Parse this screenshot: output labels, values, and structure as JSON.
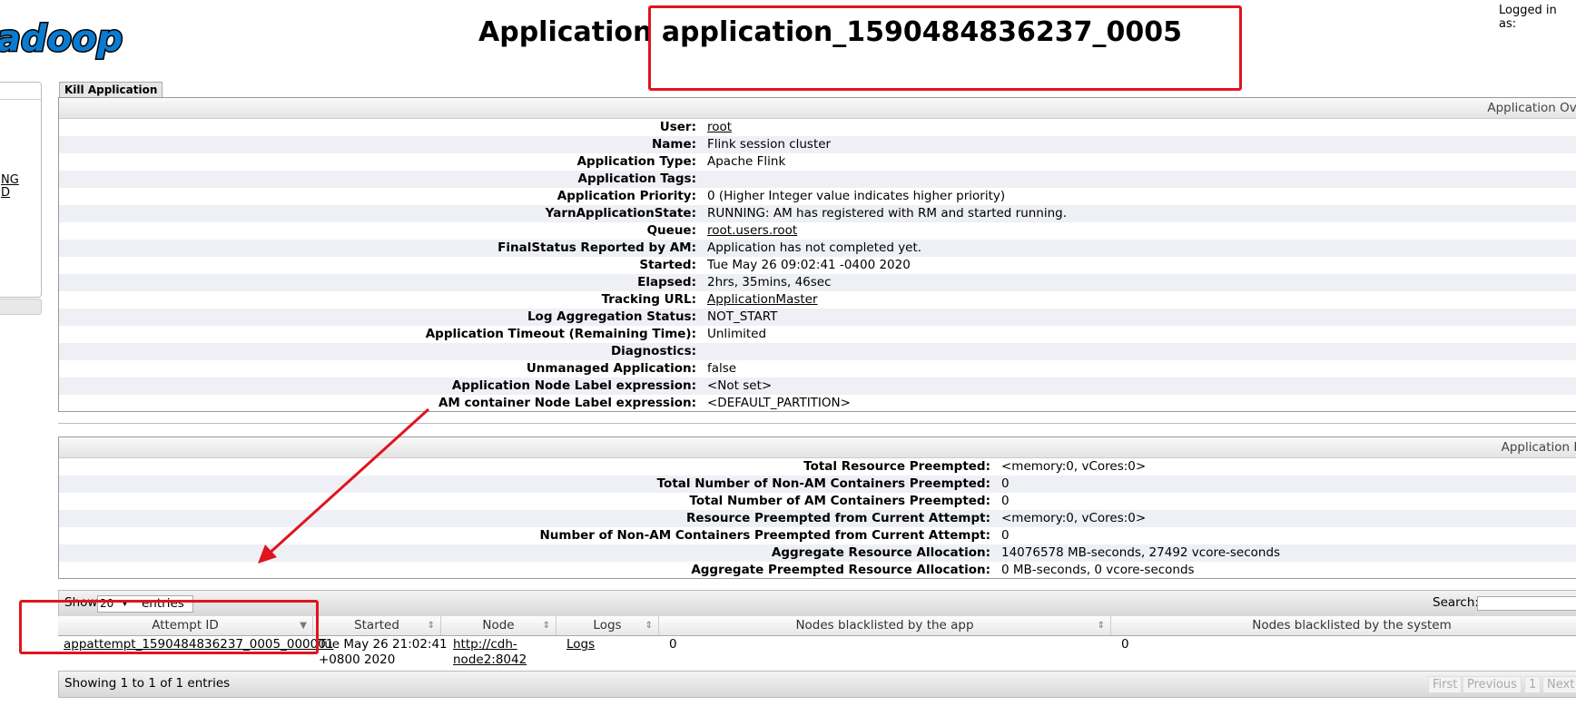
{
  "header": {
    "logo_text": "adoop",
    "title_prefix": "Application",
    "title_app_id": "application_1590484836237_0005",
    "logged_in": "Logged in as:"
  },
  "nav": {
    "links": [
      "NG",
      "D"
    ]
  },
  "kill_button": "Kill Application",
  "overview": {
    "header": "Application Ove",
    "rows": [
      {
        "key": "User:",
        "value": "root",
        "link": true
      },
      {
        "key": "Name:",
        "value": "Flink session cluster"
      },
      {
        "key": "Application Type:",
        "value": "Apache Flink"
      },
      {
        "key": "Application Tags:",
        "value": ""
      },
      {
        "key": "Application Priority:",
        "value": "0 (Higher Integer value indicates higher priority)"
      },
      {
        "key": "YarnApplicationState:",
        "value": "RUNNING: AM has registered with RM and started running."
      },
      {
        "key": "Queue:",
        "value": "root.users.root",
        "link": true
      },
      {
        "key": "FinalStatus Reported by AM:",
        "value": "Application has not completed yet."
      },
      {
        "key": "Started:",
        "value": "Tue May 26 09:02:41 -0400 2020"
      },
      {
        "key": "Elapsed:",
        "value": "2hrs, 35mins, 46sec"
      },
      {
        "key": "Tracking URL:",
        "value": "ApplicationMaster",
        "link": true
      },
      {
        "key": "Log Aggregation Status:",
        "value": "NOT_START"
      },
      {
        "key": "Application Timeout (Remaining Time):",
        "value": "Unlimited"
      },
      {
        "key": "Diagnostics:",
        "value": ""
      },
      {
        "key": "Unmanaged Application:",
        "value": "false"
      },
      {
        "key": "Application Node Label expression:",
        "value": "<Not set>"
      },
      {
        "key": "AM container Node Label expression:",
        "value": "<DEFAULT_PARTITION>"
      }
    ]
  },
  "metrics": {
    "header": "Application M",
    "rows": [
      {
        "key": "Total Resource Preempted:",
        "value": "<memory:0, vCores:0>"
      },
      {
        "key": "Total Number of Non-AM Containers Preempted:",
        "value": "0"
      },
      {
        "key": "Total Number of AM Containers Preempted:",
        "value": "0"
      },
      {
        "key": "Resource Preempted from Current Attempt:",
        "value": "<memory:0, vCores:0>"
      },
      {
        "key": "Number of Non-AM Containers Preempted from Current Attempt:",
        "value": "0"
      },
      {
        "key": "Aggregate Resource Allocation:",
        "value": "14076578 MB-seconds, 27492 vcore-seconds"
      },
      {
        "key": "Aggregate Preempted Resource Allocation:",
        "value": "0 MB-seconds, 0 vcore-seconds"
      }
    ]
  },
  "attempts": {
    "show_label": "Show",
    "entries_label": "entries",
    "page_size": "20",
    "search_label": "Search:",
    "search_value": "",
    "columns": [
      "Attempt ID",
      "Started",
      "Node",
      "Logs",
      "Nodes blacklisted by the app",
      "Nodes blacklisted by the system"
    ],
    "rows": [
      {
        "attempt_id": "appattempt_1590484836237_0005_000001",
        "started_line1": "Tue May 26 21:02:41",
        "started_line2": "+0800 2020",
        "node_line1": "http://cdh-",
        "node_line2": "node2:8042",
        "logs": "Logs",
        "blacklisted_app": "0",
        "blacklisted_system": "0"
      }
    ],
    "info": "Showing 1 to 1 of 1 entries",
    "pager": {
      "first": "First",
      "previous": "Previous",
      "page": "1",
      "next": "Next"
    }
  },
  "colors": {
    "annotation_red": "#e0141e",
    "logo_blue": "#0a7bd0",
    "row_stripe": "#eef0f6"
  }
}
